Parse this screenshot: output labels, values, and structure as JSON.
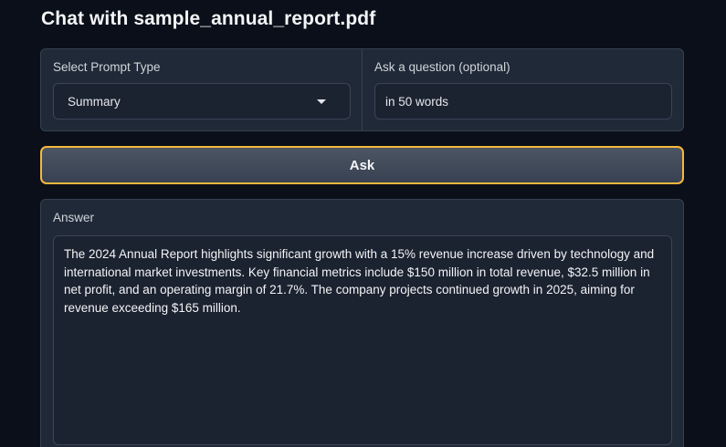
{
  "page": {
    "title": "Chat with sample_annual_report.pdf"
  },
  "prompt_type": {
    "label": "Select Prompt Type",
    "selected": "Summary"
  },
  "question": {
    "label": "Ask a question (optional)",
    "value": "in 50 words"
  },
  "ask_button": {
    "label": "Ask"
  },
  "answer": {
    "label": "Answer",
    "text": "The 2024 Annual Report highlights significant growth with a 15% revenue increase driven by technology and international market investments. Key financial metrics include $150 million in total revenue, $32.5 million in net profit, and an operating margin of 21.7%. The company projects continued growth in 2025, aiming for revenue exceeding $165 million."
  },
  "colors": {
    "background": "#0b0f19",
    "panel": "#1f2937",
    "accent_border": "#f5b83d"
  },
  "icons": {
    "dropdown": "chevron-down-icon"
  }
}
